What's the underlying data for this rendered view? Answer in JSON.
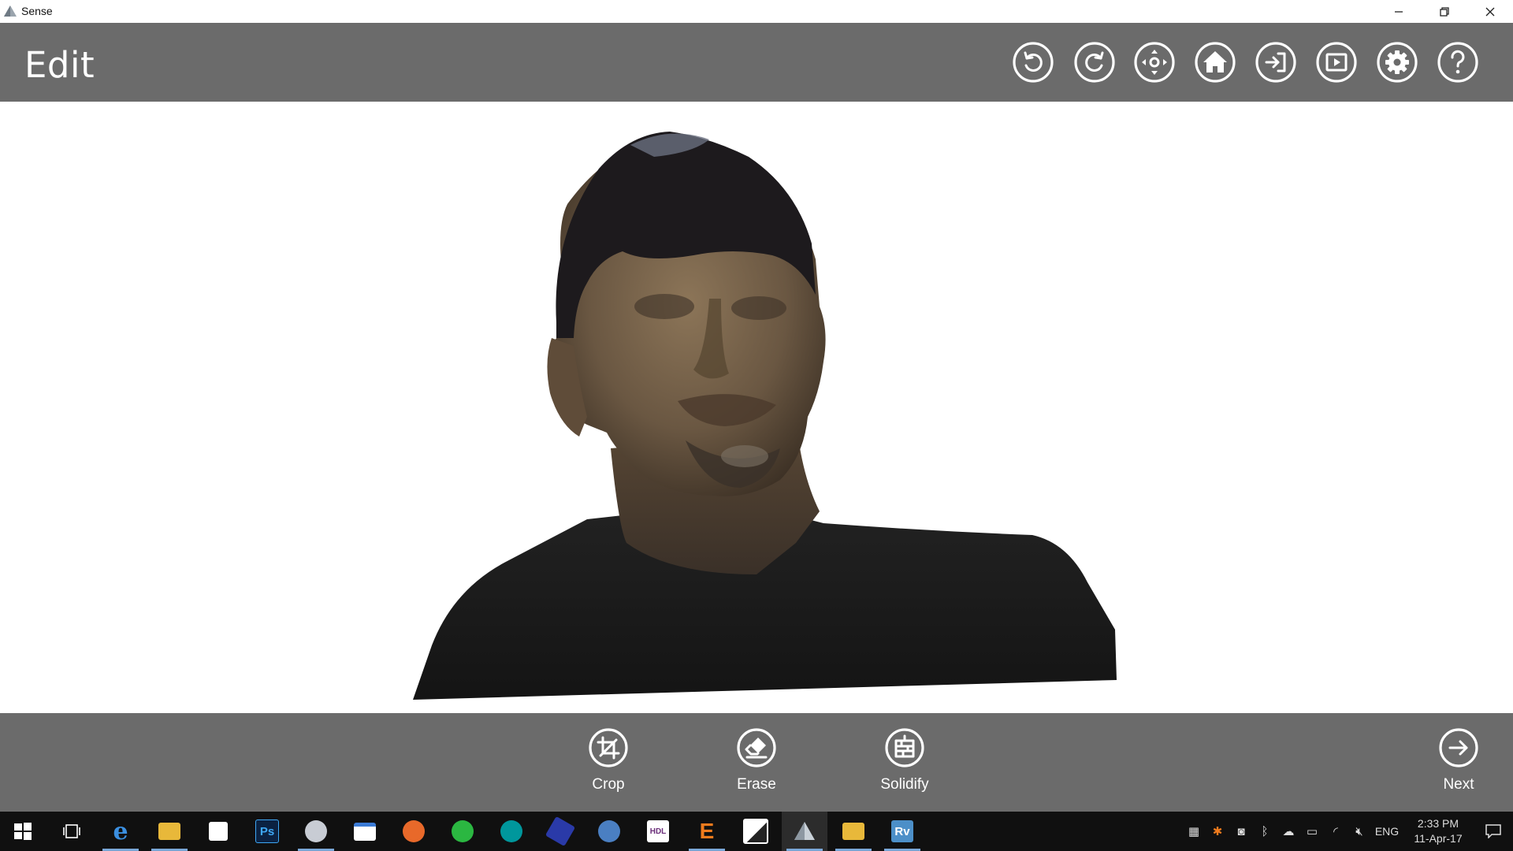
{
  "window": {
    "title": "Sense",
    "controls": [
      "minimize-icon",
      "restore-icon",
      "close-icon"
    ]
  },
  "header": {
    "title": "Edit",
    "buttons": [
      {
        "name": "undo-button",
        "icon": "undo-icon"
      },
      {
        "name": "redo-button",
        "icon": "redo-icon"
      },
      {
        "name": "move-button",
        "icon": "move-arrows-icon"
      },
      {
        "name": "home-button",
        "icon": "home-icon"
      },
      {
        "name": "import-button",
        "icon": "import-icon"
      },
      {
        "name": "play-button",
        "icon": "play-icon"
      },
      {
        "name": "settings-button",
        "icon": "gear-icon"
      },
      {
        "name": "help-button",
        "icon": "help-icon"
      }
    ]
  },
  "viewport": {
    "content": "3d-scan-model",
    "background": "#ffffff"
  },
  "toolbar": {
    "crop_label": "Crop",
    "erase_label": "Erase",
    "solidify_label": "Solidify",
    "next_label": "Next"
  },
  "taskbar": {
    "apps": [
      "windows-start-icon",
      "task-view-icon",
      "edge-icon",
      "file-explorer-icon",
      "store-icon",
      "photoshop-icon",
      "snipping-tool-icon",
      "app-window-icon",
      "firefox-icon",
      "whatsapp-icon",
      "arduino-icon",
      "hexagon-app-icon",
      "mail-app-icon",
      "hdl-app-icon",
      "e-app-icon",
      "photos-icon",
      "sense-icon",
      "folder-cloud-icon",
      "revit-icon"
    ],
    "photoshop_label": "Ps",
    "hdl_label": "HDL",
    "e_label": "E",
    "revit_label": "Rv",
    "language": "ENG",
    "time": "2:33 PM",
    "date": "11-Apr-17"
  },
  "colors": {
    "bar_gray": "#6b6b6b",
    "taskbar": "#101010",
    "accent": "#7aa7d8"
  }
}
